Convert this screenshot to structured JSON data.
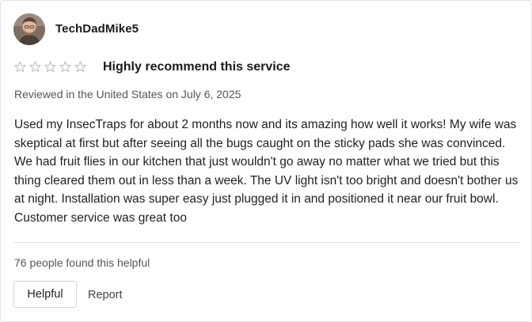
{
  "review": {
    "username": "TechDadMike5",
    "rating": 0,
    "rating_max": 5,
    "title": "Highly recommend this service",
    "meta": "Reviewed in the United States on July 6, 2025",
    "body": "Used my InsecTraps for about 2 months now and its amazing how well it works! My wife was skeptical at first but after seeing all the bugs caught on the sticky pads she was convinced. We had fruit flies in our kitchen that just wouldn't go away no matter what we tried but this thing cleared them out in less than a week. The UV light isn't too bright and doesn't bother us at night. Installation was super easy just plugged it in and positioned it near our fruit bowl. Customer service was great too",
    "helpful_count_text": "76 people found this helpful",
    "helpful_button_label": "Helpful",
    "report_label": "Report"
  },
  "icons": {
    "star": "star-outline-icon",
    "avatar": "user-avatar-photo"
  },
  "colors": {
    "star_outline": "#b5b5b5",
    "border": "#e3e3e3",
    "muted_text": "#555555"
  }
}
